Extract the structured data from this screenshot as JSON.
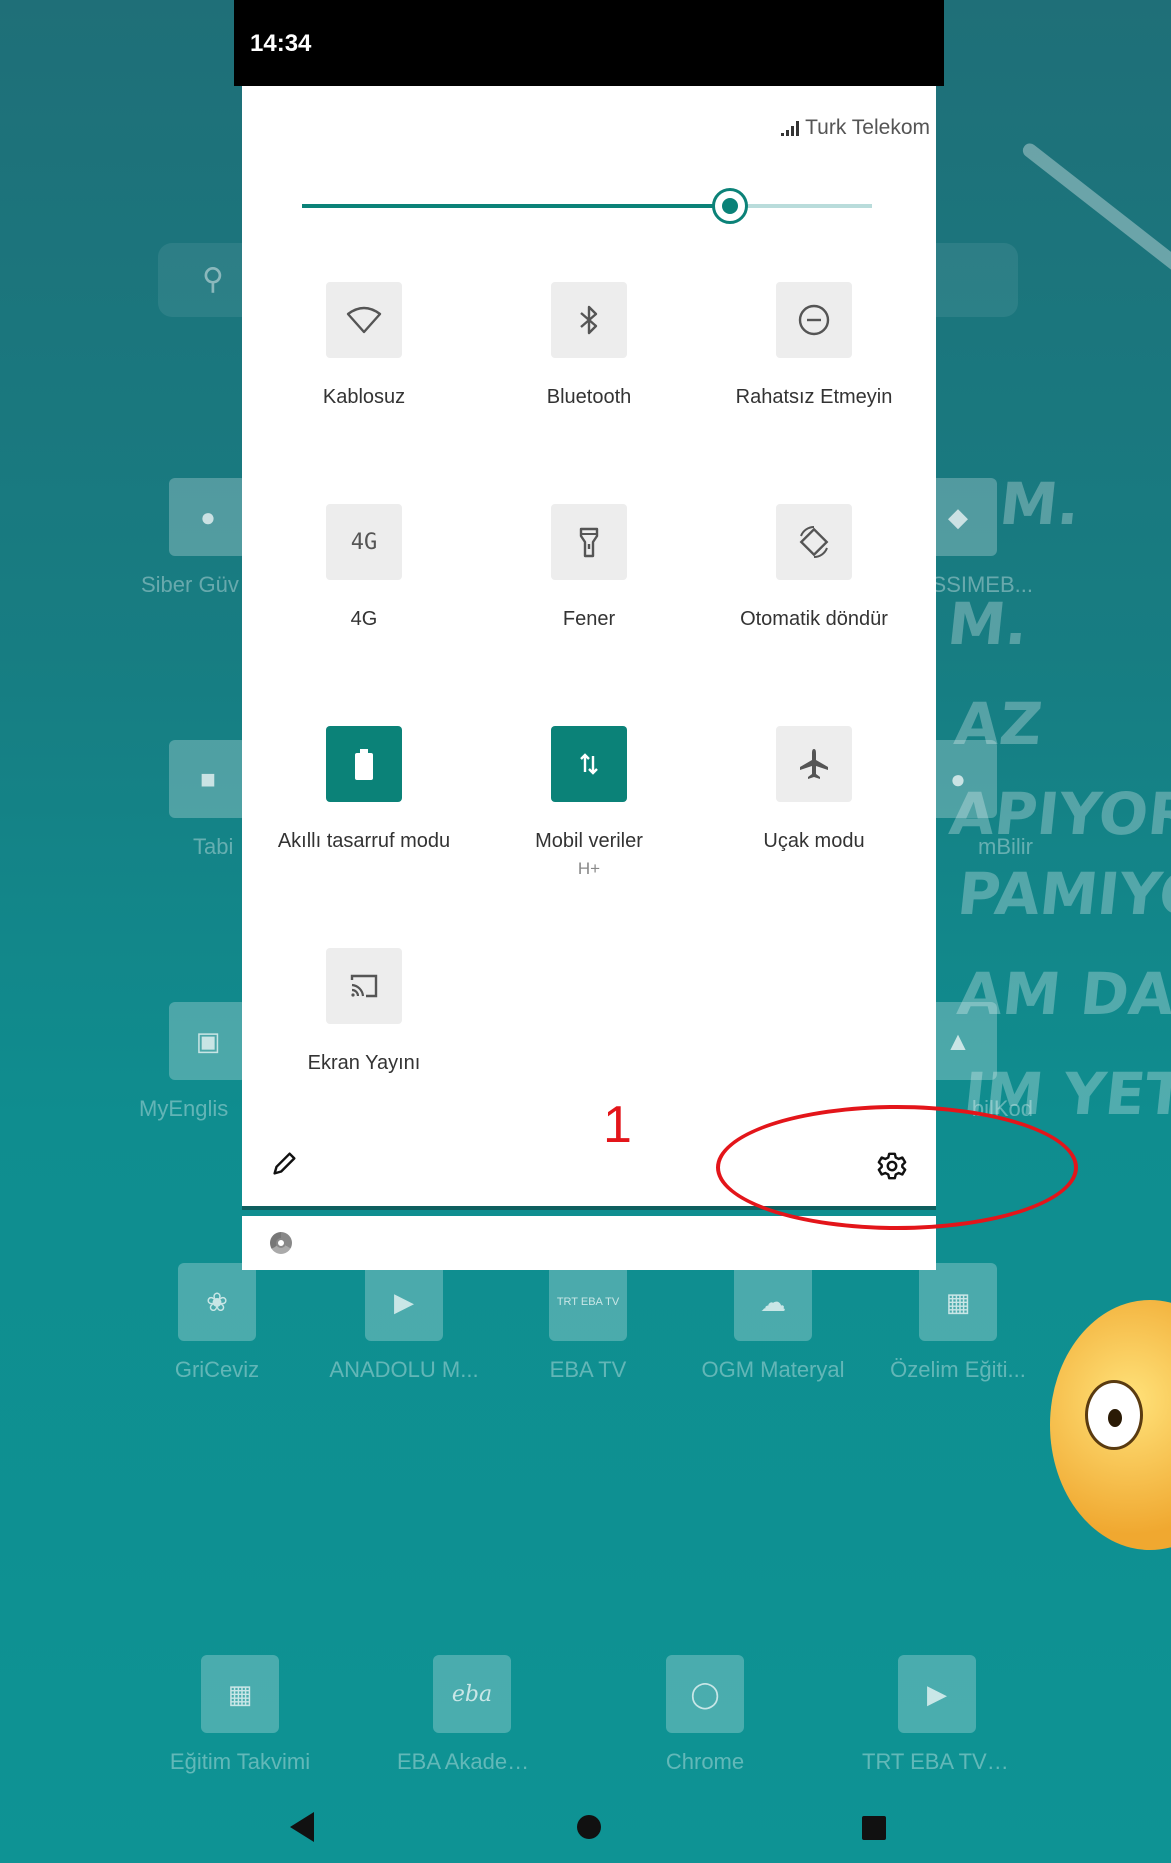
{
  "status_bar": {
    "time": "14:34"
  },
  "quick_settings": {
    "carrier": "Turk Telekom",
    "brightness": 0.75,
    "tiles": [
      {
        "id": "wifi",
        "label": "Kablosuz",
        "icon": "wifi-icon",
        "active": false
      },
      {
        "id": "bluetooth",
        "label": "Bluetooth",
        "icon": "bluetooth-icon",
        "active": false
      },
      {
        "id": "dnd",
        "label": "Rahatsız Etmeyin",
        "icon": "do-not-disturb-icon",
        "active": false
      },
      {
        "id": "4g",
        "label": "4G",
        "icon_text": "4G",
        "icon": "4g-icon",
        "active": false
      },
      {
        "id": "flashlight",
        "label": "Fener",
        "icon": "flashlight-icon",
        "active": false
      },
      {
        "id": "autorotate",
        "label": "Otomatik döndür",
        "icon": "auto-rotate-icon",
        "active": false
      },
      {
        "id": "battery_saver",
        "label": "Akıllı tasarruf modu",
        "icon": "battery-icon",
        "active": true
      },
      {
        "id": "mobile_data",
        "label": "Mobil veriler",
        "sublabel": "H+",
        "icon": "mobile-data-icon",
        "active": true
      },
      {
        "id": "airplane",
        "label": "Uçak modu",
        "icon": "airplane-icon",
        "active": false
      },
      {
        "id": "cast",
        "label": "Ekran Yayını",
        "icon": "cast-icon",
        "active": false
      }
    ]
  },
  "annotation": {
    "number": "1"
  },
  "home_apps": [
    {
      "label": "Siber Güv",
      "icon": "siber-app-icon"
    },
    {
      "label": "SSIMEB...",
      "icon": "ssimeb-app-icon"
    },
    {
      "label": "Tabi",
      "icon": "tabi-app-icon"
    },
    {
      "label": "mBilir",
      "icon": "mbilir-app-icon"
    },
    {
      "label": "MyEnglis",
      "icon": "myenglish-app-icon"
    },
    {
      "label": "bilKod",
      "icon": "bilkod-app-icon"
    },
    {
      "label": "GriCeviz",
      "icon": "griceviz-app-icon"
    },
    {
      "label": "ANADOLU M...",
      "icon": "youtube-app-icon"
    },
    {
      "label": "EBA TV",
      "icon": "ebatv-app-icon",
      "icon_text": "TRT EBA TV"
    },
    {
      "label": "OGM Materyal",
      "icon": "ogm-app-icon"
    },
    {
      "label": "Özelim Eğiti...",
      "icon": "ozelim-app-icon"
    },
    {
      "label": "Eğitim Takvimi",
      "icon": "calendar-app-icon"
    },
    {
      "label": "EBA Akademik De...",
      "icon": "eba-app-icon",
      "icon_text": "eba"
    },
    {
      "label": "Chrome",
      "icon": "chrome-app-icon"
    },
    {
      "label": "TRT EBA TV YAYI...",
      "icon": "youtube-app-icon"
    }
  ],
  "wallpaper_text": [
    "M.",
    "M.",
    "AZ",
    "APIYOR,",
    "PAMIYORUN",
    "AM DA OLU",
    "IM YETER."
  ],
  "colors": {
    "accent": "#0b8278",
    "annotation": "#e3151a",
    "panel": "#ffffff"
  }
}
